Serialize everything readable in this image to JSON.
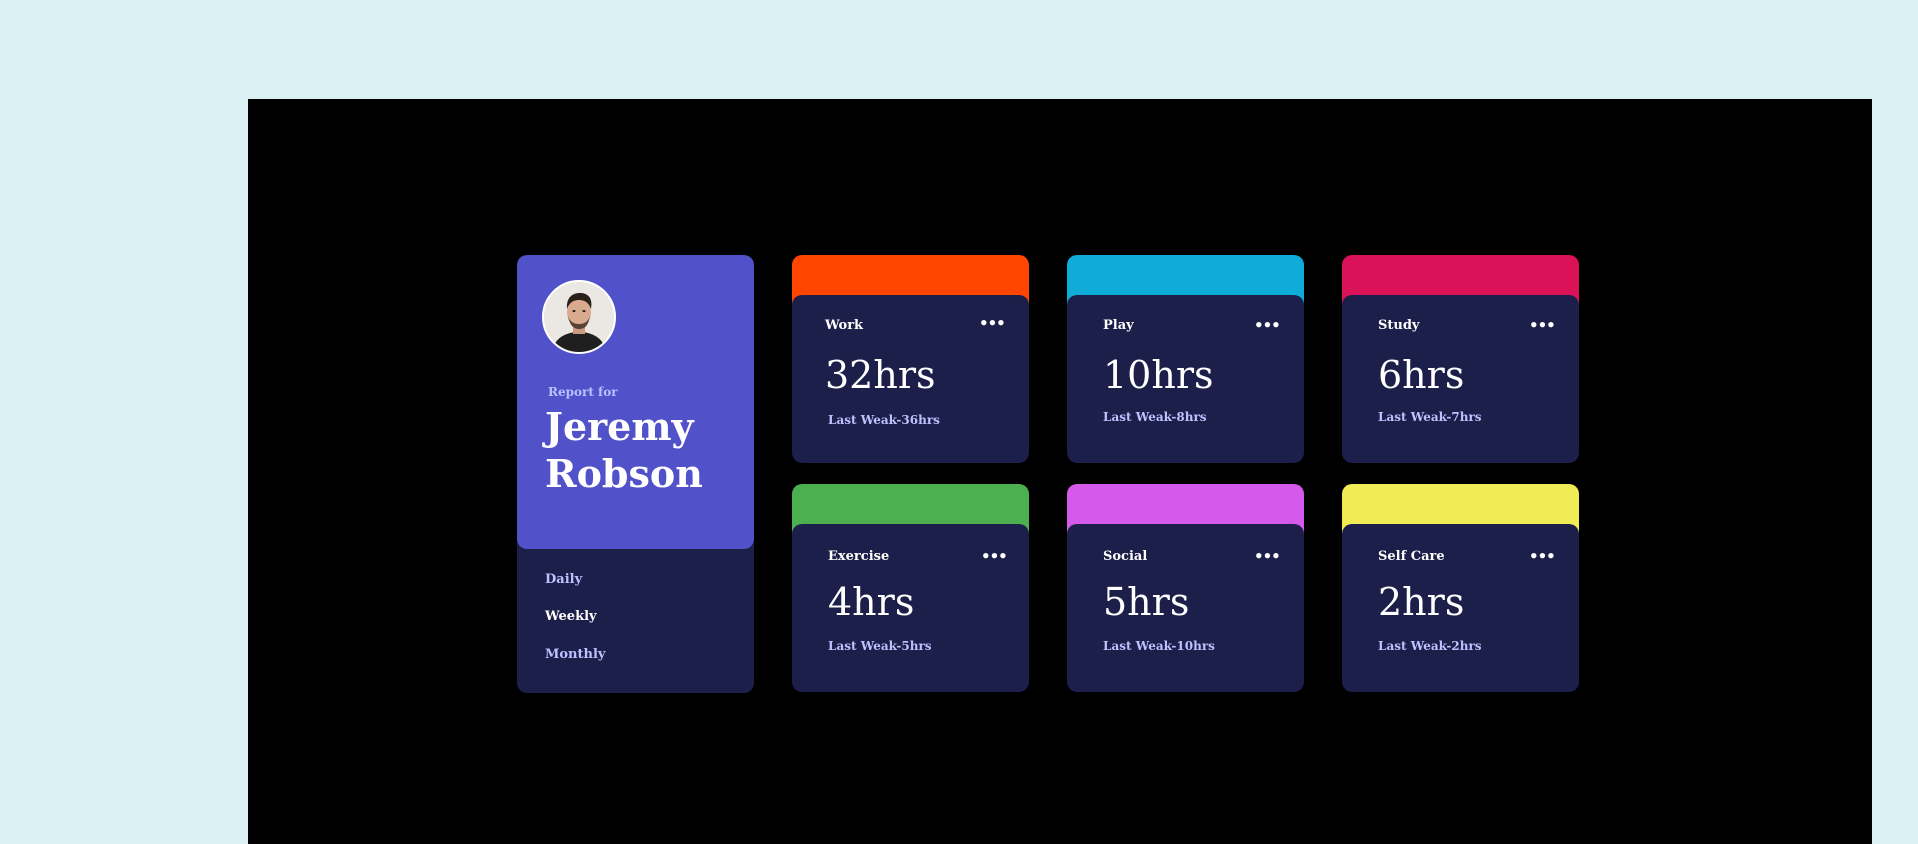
{
  "profile": {
    "report_for": "Report for",
    "name": "Jeremy Robson",
    "periods": [
      {
        "label": "Daily",
        "active": false
      },
      {
        "label": "Weekly",
        "active": true
      },
      {
        "label": "Monthly",
        "active": false
      }
    ]
  },
  "cards": [
    {
      "title": "Work",
      "hours": "32hrs",
      "last": "Last Weak-36hrs",
      "color": "#ff4500",
      "menu_icon": "ellipsis-icon"
    },
    {
      "title": "Play",
      "hours": "10hrs",
      "last": "Last Weak-8hrs",
      "color": "#10acd9",
      "menu_icon": "ellipsis-icon"
    },
    {
      "title": "Study",
      "hours": "6hrs",
      "last": "Last Weak-7hrs",
      "color": "#dc1258",
      "menu_icon": "ellipsis-icon"
    },
    {
      "title": "Exercise",
      "hours": "4hrs",
      "last": "Last Weak-5hrs",
      "color": "#4caf50",
      "menu_icon": "ellipsis-icon"
    },
    {
      "title": "Social",
      "hours": "5hrs",
      "last": "Last Weak-10hrs",
      "color": "#d55aeb",
      "menu_icon": "ellipsis-icon"
    },
    {
      "title": "Self Care",
      "hours": "2hrs",
      "last": "Last Weak-2hrs",
      "color": "#f0ec55",
      "menu_icon": "ellipsis-icon"
    }
  ],
  "menu_glyph": "•••"
}
